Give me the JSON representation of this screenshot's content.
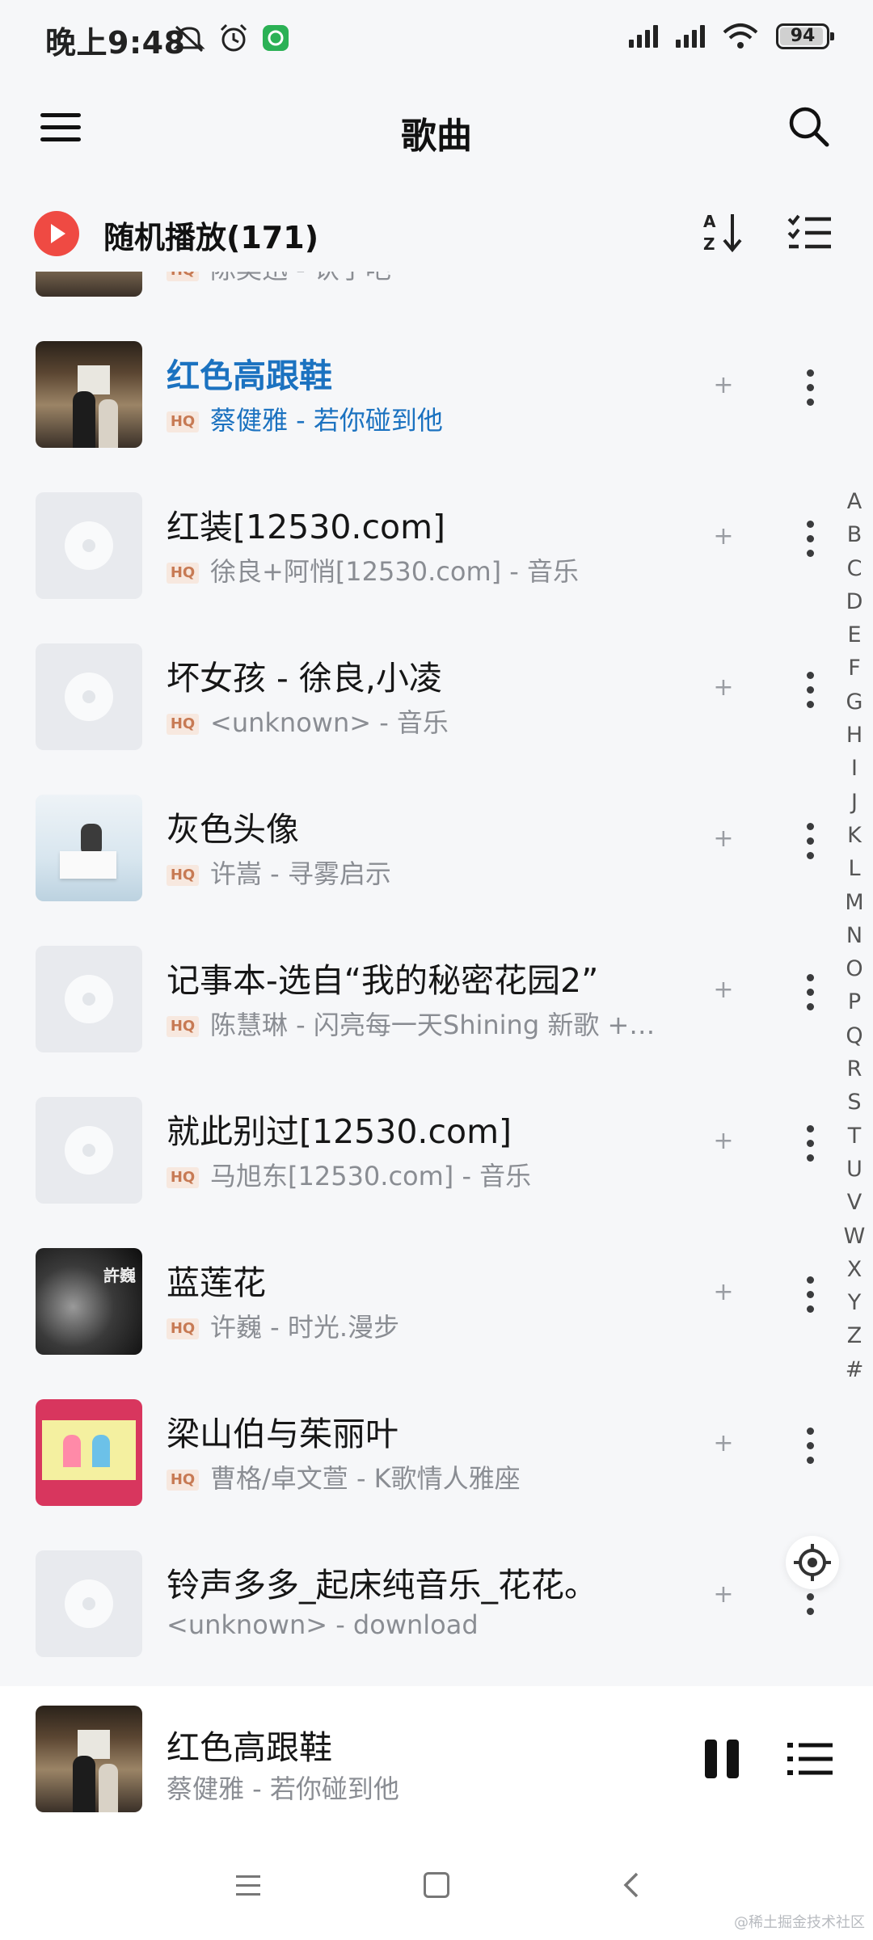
{
  "status_bar": {
    "time": "晚上9:48",
    "battery": "94",
    "battery_level_percent": 94,
    "left_icons": [
      "mute-icon",
      "alarm-icon",
      "app-notification-icon"
    ],
    "right_icons": [
      "signal-icon",
      "signal-icon",
      "wifi-icon",
      "battery-icon"
    ]
  },
  "header": {
    "title": "歌曲",
    "menu_icon": "hamburger-menu-icon",
    "search_icon": "search-icon"
  },
  "shuffle": {
    "label": "随机播放(171)",
    "sort_icon": "sort-az-icon",
    "multi_select_icon": "list-check-icon"
  },
  "songs": [
    {
      "title": "",
      "subtitle": "陈奕迅 - 认了吧",
      "hq": true,
      "cover": "photo",
      "playing": false
    },
    {
      "title": "红色高跟鞋",
      "subtitle": "蔡健雅 - 若你碰到他",
      "hq": true,
      "cover": "station-photo",
      "playing": true
    },
    {
      "title": "红装[12530.com]",
      "subtitle": "徐良+阿悄[12530.com] - 音乐",
      "hq": true,
      "cover": "disc-placeholder",
      "playing": false
    },
    {
      "title": "坏女孩 - 徐良,小凌",
      "subtitle": "<unknown> - 音乐",
      "hq": true,
      "cover": "disc-placeholder",
      "playing": false
    },
    {
      "title": "灰色头像",
      "subtitle": "许嵩 - 寻雾启示",
      "hq": true,
      "cover": "piano-photo",
      "playing": false
    },
    {
      "title": "记事本-选自“我的秘密花园2”",
      "subtitle": "陈慧琳 - 闪亮每一天Shining 新歌 +…",
      "hq": true,
      "cover": "disc-placeholder",
      "playing": false
    },
    {
      "title": "就此别过[12530.com]",
      "subtitle": "马旭东[12530.com] - 音乐",
      "hq": true,
      "cover": "disc-placeholder",
      "playing": false
    },
    {
      "title": "蓝莲花",
      "subtitle": "许巍 - 时光.漫步",
      "hq": true,
      "cover": "bw-portrait",
      "playing": false
    },
    {
      "title": "梁山伯与茱丽叶",
      "subtitle": "曹格/卓文萱 - K歌情人雅座",
      "hq": true,
      "cover": "pink-album",
      "playing": false
    },
    {
      "title": "铃声多多_起床纯音乐_花花。",
      "subtitle": "<unknown> - download",
      "hq": false,
      "cover": "disc-placeholder",
      "playing": false
    }
  ],
  "row_actions": {
    "add": "+",
    "more_icon": "more-vertical-icon"
  },
  "hq_badge": "HQ",
  "alphabet": [
    "A",
    "B",
    "C",
    "D",
    "E",
    "F",
    "G",
    "H",
    "I",
    "J",
    "K",
    "L",
    "M",
    "N",
    "O",
    "P",
    "Q",
    "R",
    "S",
    "T",
    "U",
    "V",
    "W",
    "X",
    "Y",
    "Z",
    "#"
  ],
  "locate_icon": "locate-target-icon",
  "player": {
    "title": "红色高跟鞋",
    "subtitle": "蔡健雅 - 若你碰到他",
    "pause_icon": "pause-icon",
    "queue_icon": "playlist-icon"
  },
  "nav": {
    "menu_icon": "recent-apps-icon",
    "home_icon": "home-icon",
    "back_icon": "back-icon"
  },
  "watermark": "@稀土掘金技术社区",
  "colors": {
    "accent": "#1b72c0",
    "shuffle": "#ef4a43",
    "hq_bg": "#f7e8df",
    "hq_text": "#c77a54"
  }
}
